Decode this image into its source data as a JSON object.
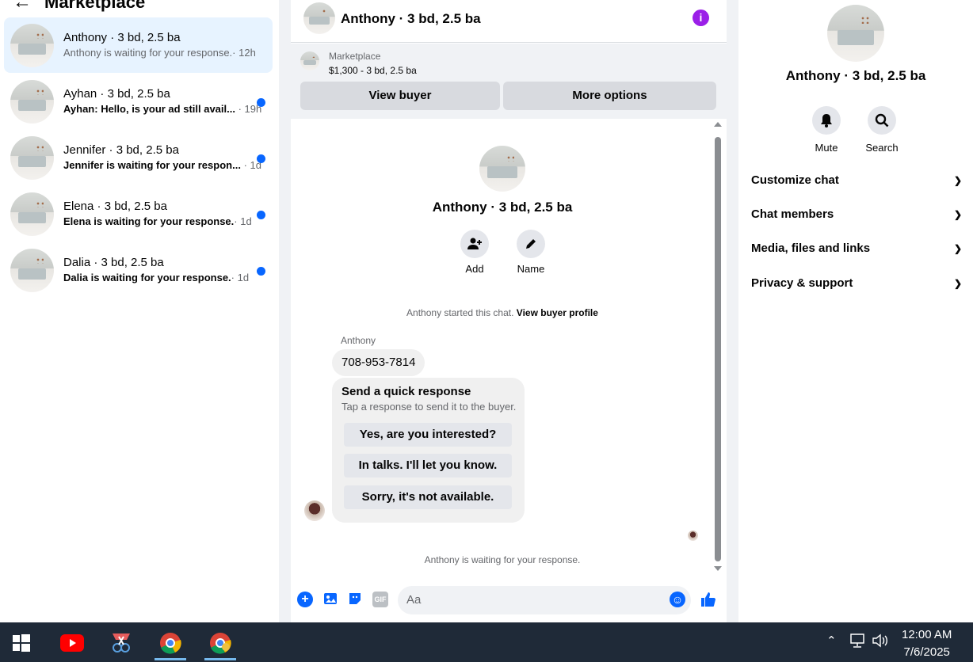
{
  "header": {
    "back_icon": "arrow-left-icon",
    "title": "Marketplace"
  },
  "conversations": [
    {
      "name": "Anthony · 3 bd, 2.5 ba",
      "snippet": "Anthony is waiting for your response.",
      "time": "· 12h",
      "unread": false,
      "active": true
    },
    {
      "name": "Ayhan · 3 bd, 2.5 ba",
      "snippet": "Ayhan: Hello, is your ad still avail...",
      "time": "· 19h",
      "unread": true,
      "active": false
    },
    {
      "name": "Jennifer · 3 bd, 2.5 ba",
      "snippet": "Jennifer is waiting for your respon...",
      "time": "· 1d",
      "unread": true,
      "active": false
    },
    {
      "name": "Elena · 3 bd, 2.5 ba",
      "snippet": "Elena is waiting for your response.",
      "time": "· 1d",
      "unread": true,
      "active": false
    },
    {
      "name": "Dalia · 3 bd, 2.5 ba",
      "snippet": "Dalia is waiting for your response.",
      "time": "· 1d",
      "unread": true,
      "active": false
    }
  ],
  "chat": {
    "title": "Anthony · 3 bd, 2.5 ba",
    "info_icon": "info-icon",
    "marketplace_label": "Marketplace",
    "listing": "$1,300 - 3 bd, 2.5 ba",
    "view_buyer": "View buyer",
    "more_options": "More options",
    "profile_name": "Anthony · 3 bd, 2.5 ba",
    "add_label": "Add",
    "name_label": "Name",
    "started_text": "Anthony started this chat.",
    "view_profile": "View buyer profile",
    "sender": "Anthony",
    "message": "708-953-7814",
    "quick_title": "Send a quick response",
    "quick_sub": "Tap a response to send it to the buyer.",
    "quick_replies": [
      "Yes, are you interested?",
      "In talks. I'll let you know.",
      "Sorry, it's not available."
    ],
    "waiting": "Anthony is waiting for your response.",
    "input_placeholder": "Aa"
  },
  "details": {
    "name": "Anthony · 3 bd, 2.5 ba",
    "mute_label": "Mute",
    "search_label": "Search",
    "sections": [
      "Customize chat",
      "Chat members",
      "Media, files and links",
      "Privacy & support"
    ]
  },
  "taskbar": {
    "time": "12:00 AM",
    "date": "7/6/2025"
  },
  "colors": {
    "accent": "#0866ff",
    "info": "#9b1fe8",
    "taskbar": "#1f2a38"
  }
}
